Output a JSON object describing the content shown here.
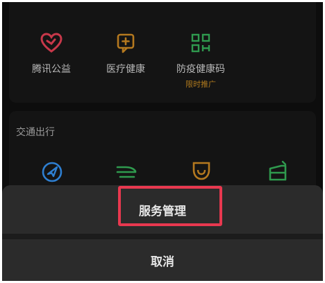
{
  "services": [
    {
      "label": "腾讯公益",
      "icon": "heart-charity-icon",
      "color": "#c8384a"
    },
    {
      "label": "医疗健康",
      "icon": "medical-chat-icon",
      "color": "#b5791f"
    },
    {
      "label": "防疫健康码",
      "icon": "qr-code-icon",
      "color": "#2f9a4e",
      "sub": "限时推广"
    }
  ],
  "transport": {
    "title": "交通出行",
    "icons": [
      {
        "icon": "navigation-compass-icon",
        "color": "#2e7fd1"
      },
      {
        "icon": "train-icon",
        "color": "#2f9a4e"
      },
      {
        "icon": "taxi-icon",
        "color": "#b5791f"
      },
      {
        "icon": "bus-icon",
        "color": "#2f9a4e"
      }
    ]
  },
  "sheet": {
    "option_label": "服务管理",
    "cancel_label": "取消"
  },
  "colors": {
    "background": "#0d0d0d",
    "sheet": "#2b2b2b",
    "highlight": "#e8384f"
  }
}
